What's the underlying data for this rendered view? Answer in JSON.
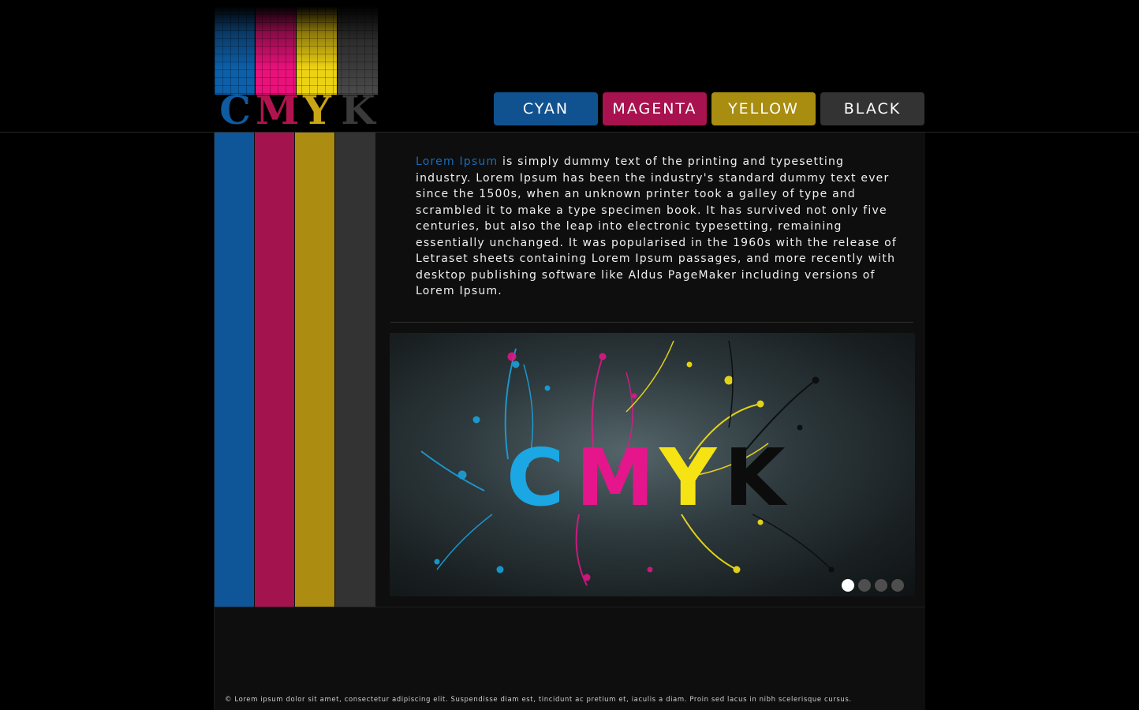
{
  "logo": {
    "letters": [
      "C",
      "M",
      "Y",
      "K"
    ]
  },
  "nav": {
    "items": [
      {
        "label": "CYAN",
        "color": "#10528f"
      },
      {
        "label": "MAGENTA",
        "color": "#a8124e"
      },
      {
        "label": "YELLOW",
        "color": "#a88d11"
      },
      {
        "label": "BLACK",
        "color": "#333333"
      }
    ]
  },
  "intro": {
    "highlight": "Lorem Ipsum",
    "body": " is simply dummy text of the printing and typesetting industry. Lorem Ipsum has been the industry's standard dummy text ever since the 1500s, when an unknown printer took a galley of type and scrambled it to make a type specimen book. It has survived not only five centuries, but also the leap into electronic typesetting, remaining essentially unchanged. It was popularised in the 1960s with the release of Letraset sheets containing Lorem Ipsum passages, and more recently with desktop publishing software like Aldus PageMaker including versions of Lorem Ipsum."
  },
  "banner": {
    "word": "CMYK",
    "letter_colors": [
      "#1aa7e4",
      "#e5168c",
      "#f6e314",
      "#0c0c0c"
    ],
    "slides": 4,
    "active_slide": 1
  },
  "footer": {
    "text": "© Lorem ipsum dolor sit amet, consectetur adipiscing elit. Suspendisse diam est, tincidunt ac pretium et, iaculis a diam. Proin sed lacus in nibh scelerisque cursus."
  }
}
